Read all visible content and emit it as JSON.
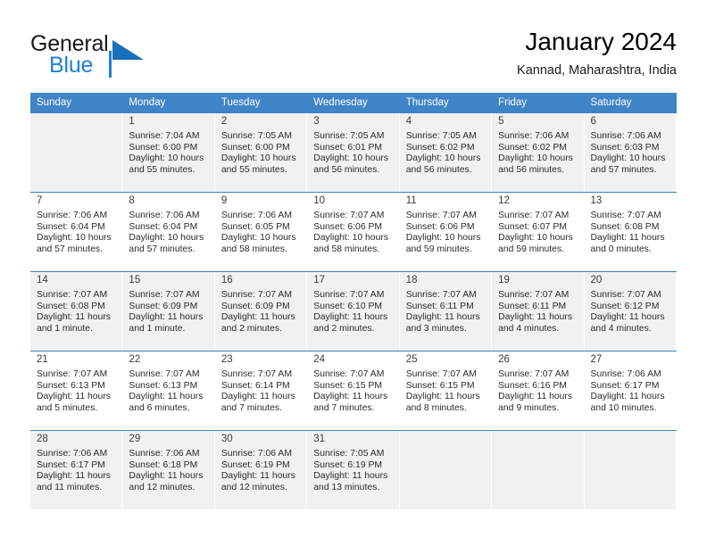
{
  "brand": {
    "name_top": "General",
    "name_bottom": "Blue",
    "triangle_color": "#1a6fbd",
    "blue_color": "#1f7fd4"
  },
  "header": {
    "title": "January 2024",
    "subtitle": "Kannad, Maharashtra, India"
  },
  "calendar": {
    "header_color": "#3f84c6",
    "shaded_row_color": "#f1f1f1",
    "weekdays": [
      "Sunday",
      "Monday",
      "Tuesday",
      "Wednesday",
      "Thursday",
      "Friday",
      "Saturday"
    ],
    "weeks": [
      [
        {
          "day": "",
          "sunrise": "",
          "sunset": "",
          "daylight1": "",
          "daylight2": "",
          "empty": true
        },
        {
          "day": "1",
          "sunrise": "Sunrise: 7:04 AM",
          "sunset": "Sunset: 6:00 PM",
          "daylight1": "Daylight: 10 hours",
          "daylight2": "and 55 minutes."
        },
        {
          "day": "2",
          "sunrise": "Sunrise: 7:05 AM",
          "sunset": "Sunset: 6:00 PM",
          "daylight1": "Daylight: 10 hours",
          "daylight2": "and 55 minutes."
        },
        {
          "day": "3",
          "sunrise": "Sunrise: 7:05 AM",
          "sunset": "Sunset: 6:01 PM",
          "daylight1": "Daylight: 10 hours",
          "daylight2": "and 56 minutes."
        },
        {
          "day": "4",
          "sunrise": "Sunrise: 7:05 AM",
          "sunset": "Sunset: 6:02 PM",
          "daylight1": "Daylight: 10 hours",
          "daylight2": "and 56 minutes."
        },
        {
          "day": "5",
          "sunrise": "Sunrise: 7:06 AM",
          "sunset": "Sunset: 6:02 PM",
          "daylight1": "Daylight: 10 hours",
          "daylight2": "and 56 minutes."
        },
        {
          "day": "6",
          "sunrise": "Sunrise: 7:06 AM",
          "sunset": "Sunset: 6:03 PM",
          "daylight1": "Daylight: 10 hours",
          "daylight2": "and 57 minutes."
        }
      ],
      [
        {
          "day": "7",
          "sunrise": "Sunrise: 7:06 AM",
          "sunset": "Sunset: 6:04 PM",
          "daylight1": "Daylight: 10 hours",
          "daylight2": "and 57 minutes."
        },
        {
          "day": "8",
          "sunrise": "Sunrise: 7:06 AM",
          "sunset": "Sunset: 6:04 PM",
          "daylight1": "Daylight: 10 hours",
          "daylight2": "and 57 minutes."
        },
        {
          "day": "9",
          "sunrise": "Sunrise: 7:06 AM",
          "sunset": "Sunset: 6:05 PM",
          "daylight1": "Daylight: 10 hours",
          "daylight2": "and 58 minutes."
        },
        {
          "day": "10",
          "sunrise": "Sunrise: 7:07 AM",
          "sunset": "Sunset: 6:06 PM",
          "daylight1": "Daylight: 10 hours",
          "daylight2": "and 58 minutes."
        },
        {
          "day": "11",
          "sunrise": "Sunrise: 7:07 AM",
          "sunset": "Sunset: 6:06 PM",
          "daylight1": "Daylight: 10 hours",
          "daylight2": "and 59 minutes."
        },
        {
          "day": "12",
          "sunrise": "Sunrise: 7:07 AM",
          "sunset": "Sunset: 6:07 PM",
          "daylight1": "Daylight: 10 hours",
          "daylight2": "and 59 minutes."
        },
        {
          "day": "13",
          "sunrise": "Sunrise: 7:07 AM",
          "sunset": "Sunset: 6:08 PM",
          "daylight1": "Daylight: 11 hours",
          "daylight2": "and 0 minutes."
        }
      ],
      [
        {
          "day": "14",
          "sunrise": "Sunrise: 7:07 AM",
          "sunset": "Sunset: 6:08 PM",
          "daylight1": "Daylight: 11 hours",
          "daylight2": "and 1 minute."
        },
        {
          "day": "15",
          "sunrise": "Sunrise: 7:07 AM",
          "sunset": "Sunset: 6:09 PM",
          "daylight1": "Daylight: 11 hours",
          "daylight2": "and 1 minute."
        },
        {
          "day": "16",
          "sunrise": "Sunrise: 7:07 AM",
          "sunset": "Sunset: 6:09 PM",
          "daylight1": "Daylight: 11 hours",
          "daylight2": "and 2 minutes."
        },
        {
          "day": "17",
          "sunrise": "Sunrise: 7:07 AM",
          "sunset": "Sunset: 6:10 PM",
          "daylight1": "Daylight: 11 hours",
          "daylight2": "and 2 minutes."
        },
        {
          "day": "18",
          "sunrise": "Sunrise: 7:07 AM",
          "sunset": "Sunset: 6:11 PM",
          "daylight1": "Daylight: 11 hours",
          "daylight2": "and 3 minutes."
        },
        {
          "day": "19",
          "sunrise": "Sunrise: 7:07 AM",
          "sunset": "Sunset: 6:11 PM",
          "daylight1": "Daylight: 11 hours",
          "daylight2": "and 4 minutes."
        },
        {
          "day": "20",
          "sunrise": "Sunrise: 7:07 AM",
          "sunset": "Sunset: 6:12 PM",
          "daylight1": "Daylight: 11 hours",
          "daylight2": "and 4 minutes."
        }
      ],
      [
        {
          "day": "21",
          "sunrise": "Sunrise: 7:07 AM",
          "sunset": "Sunset: 6:13 PM",
          "daylight1": "Daylight: 11 hours",
          "daylight2": "and 5 minutes."
        },
        {
          "day": "22",
          "sunrise": "Sunrise: 7:07 AM",
          "sunset": "Sunset: 6:13 PM",
          "daylight1": "Daylight: 11 hours",
          "daylight2": "and 6 minutes."
        },
        {
          "day": "23",
          "sunrise": "Sunrise: 7:07 AM",
          "sunset": "Sunset: 6:14 PM",
          "daylight1": "Daylight: 11 hours",
          "daylight2": "and 7 minutes."
        },
        {
          "day": "24",
          "sunrise": "Sunrise: 7:07 AM",
          "sunset": "Sunset: 6:15 PM",
          "daylight1": "Daylight: 11 hours",
          "daylight2": "and 7 minutes."
        },
        {
          "day": "25",
          "sunrise": "Sunrise: 7:07 AM",
          "sunset": "Sunset: 6:15 PM",
          "daylight1": "Daylight: 11 hours",
          "daylight2": "and 8 minutes."
        },
        {
          "day": "26",
          "sunrise": "Sunrise: 7:07 AM",
          "sunset": "Sunset: 6:16 PM",
          "daylight1": "Daylight: 11 hours",
          "daylight2": "and 9 minutes."
        },
        {
          "day": "27",
          "sunrise": "Sunrise: 7:06 AM",
          "sunset": "Sunset: 6:17 PM",
          "daylight1": "Daylight: 11 hours",
          "daylight2": "and 10 minutes."
        }
      ],
      [
        {
          "day": "28",
          "sunrise": "Sunrise: 7:06 AM",
          "sunset": "Sunset: 6:17 PM",
          "daylight1": "Daylight: 11 hours",
          "daylight2": "and 11 minutes."
        },
        {
          "day": "29",
          "sunrise": "Sunrise: 7:06 AM",
          "sunset": "Sunset: 6:18 PM",
          "daylight1": "Daylight: 11 hours",
          "daylight2": "and 12 minutes."
        },
        {
          "day": "30",
          "sunrise": "Sunrise: 7:06 AM",
          "sunset": "Sunset: 6:19 PM",
          "daylight1": "Daylight: 11 hours",
          "daylight2": "and 12 minutes."
        },
        {
          "day": "31",
          "sunrise": "Sunrise: 7:05 AM",
          "sunset": "Sunset: 6:19 PM",
          "daylight1": "Daylight: 11 hours",
          "daylight2": "and 13 minutes."
        },
        {
          "day": "",
          "sunrise": "",
          "sunset": "",
          "daylight1": "",
          "daylight2": "",
          "empty": true
        },
        {
          "day": "",
          "sunrise": "",
          "sunset": "",
          "daylight1": "",
          "daylight2": "",
          "empty": true
        },
        {
          "day": "",
          "sunrise": "",
          "sunset": "",
          "daylight1": "",
          "daylight2": "",
          "empty": true
        }
      ]
    ]
  }
}
